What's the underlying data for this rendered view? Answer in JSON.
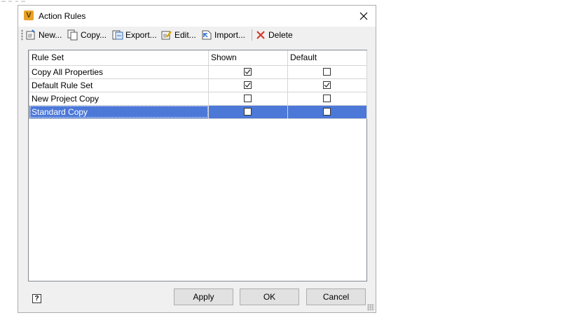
{
  "window": {
    "title": "Action Rules",
    "app_icon_letter": "V"
  },
  "toolbar": {
    "new_label": "New...",
    "copy_label": "Copy...",
    "export_label": "Export...",
    "edit_label": "Edit...",
    "import_label": "Import...",
    "delete_label": "Delete"
  },
  "grid": {
    "columns": [
      "Rule Set",
      "Shown",
      "Default"
    ],
    "rows": [
      {
        "name": "Copy All Properties",
        "shown": true,
        "default": false,
        "selected": false
      },
      {
        "name": "Default Rule Set",
        "shown": true,
        "default": true,
        "selected": false
      },
      {
        "name": "New Project Copy",
        "shown": false,
        "default": false,
        "selected": false
      },
      {
        "name": "Standard Copy",
        "shown": false,
        "default": false,
        "selected": true
      }
    ]
  },
  "footer": {
    "help_glyph": "?",
    "apply_label": "Apply",
    "ok_label": "OK",
    "cancel_label": "Cancel"
  },
  "colors": {
    "selection": "#4c78d8",
    "app_icon": "#e9a227",
    "delete_icon": "#d23b2f"
  }
}
